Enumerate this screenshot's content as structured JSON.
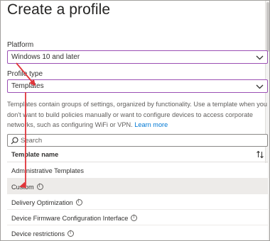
{
  "title": "Create a profile",
  "platform": {
    "label": "Platform",
    "value": "Windows 10 and later"
  },
  "profile_type": {
    "label": "Profile type",
    "value": "Templates"
  },
  "description": {
    "text": "Templates contain groups of settings, organized by functionality. Use a template when you don't want to build policies manually or want to configure devices to access corporate networks, such as configuring WiFi or VPN.",
    "link": "Learn more"
  },
  "search": {
    "placeholder": "Search"
  },
  "table": {
    "column": "Template name",
    "rows": [
      {
        "name": "Administrative Templates",
        "info": false,
        "selected": false
      },
      {
        "name": "Custom",
        "info": true,
        "selected": true
      },
      {
        "name": "Delivery Optimization",
        "info": true,
        "selected": false
      },
      {
        "name": "Device Firmware Configuration Interface",
        "info": true,
        "selected": false
      },
      {
        "name": "Device restrictions",
        "info": true,
        "selected": false
      }
    ]
  },
  "colors": {
    "accent_border": "#9b4fb4",
    "annotation_arrow": "#e0353a",
    "link": "#0078d4",
    "selected_row": "#edebe9"
  },
  "icons": [
    "chevron-down-icon",
    "search-icon",
    "sort-icon",
    "info-icon"
  ]
}
